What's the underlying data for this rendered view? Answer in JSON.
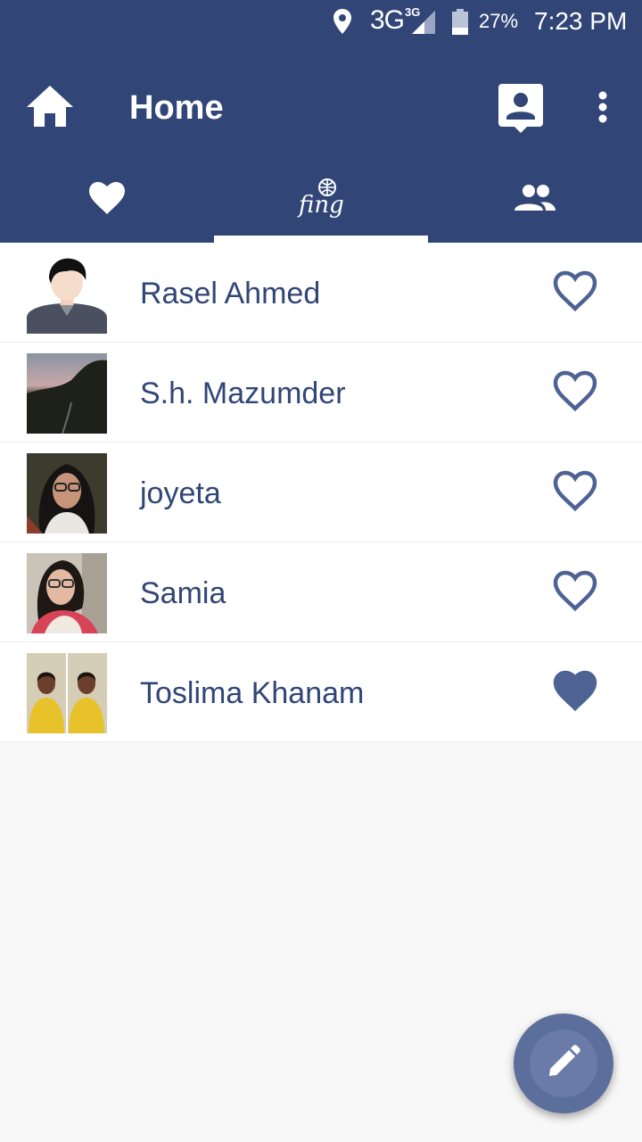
{
  "status_bar": {
    "network": "3G",
    "network_sup": "3G",
    "battery": "27%",
    "time": "7:23 PM"
  },
  "toolbar": {
    "title": "Home",
    "home_icon": "home-icon",
    "contact_icon": "contact-icon",
    "more_icon": "more-vert-icon"
  },
  "tabs": [
    {
      "icon": "heart-icon",
      "selected": false
    },
    {
      "icon": "fing-logo-icon",
      "selected": true
    },
    {
      "icon": "people-icon",
      "selected": false
    }
  ],
  "contacts": [
    {
      "name": "Rasel Ahmed",
      "favorite": false
    },
    {
      "name": "S.h. Mazumder",
      "favorite": false
    },
    {
      "name": "joyeta",
      "favorite": false
    },
    {
      "name": "Samia",
      "favorite": false
    },
    {
      "name": "Toslima Khanam",
      "favorite": true
    }
  ],
  "fab": {
    "icon": "pencil-icon"
  },
  "colors": {
    "primary": "#314677",
    "accent_fab": "#5c6e9c",
    "heart": "#4e6293"
  }
}
